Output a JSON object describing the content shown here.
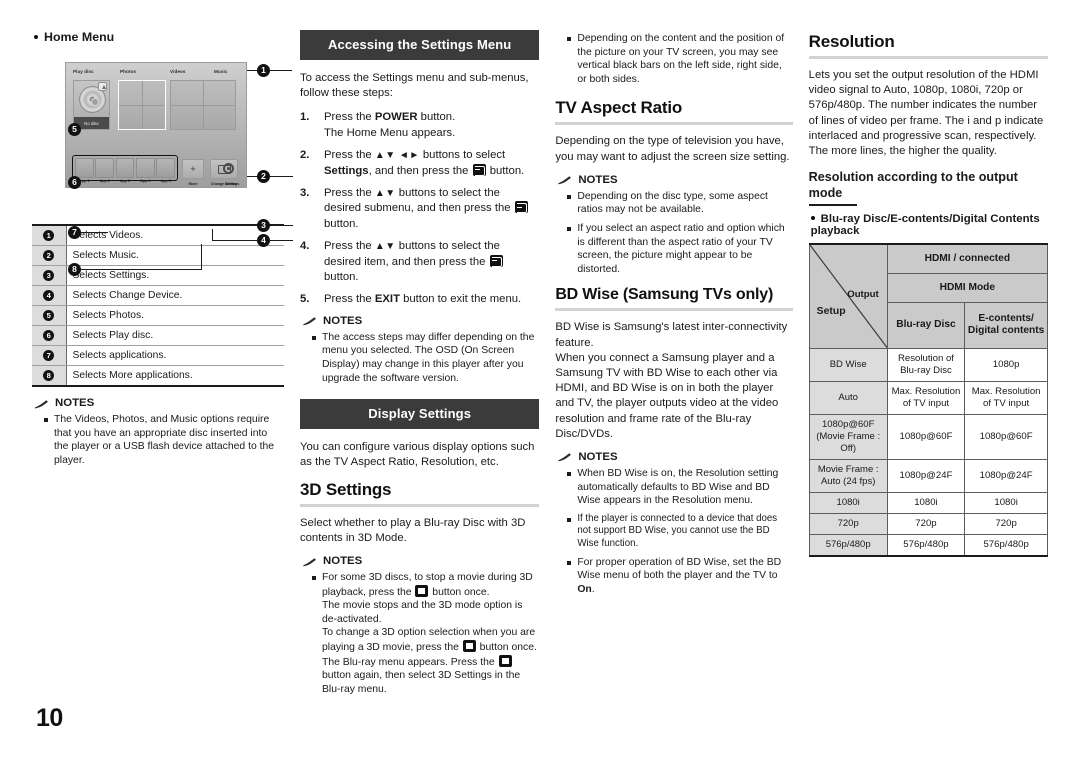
{
  "page": {
    "number": "10"
  },
  "col1": {
    "home_menu_heading": "Home Menu",
    "screenshot": {
      "labels": {
        "play_disc": "Play disc",
        "photos": "Photos",
        "videos": "Videos",
        "music": "Music",
        "no_disc": "No disc",
        "apps": [
          "App 1",
          "App 2",
          "App 3",
          "App 4",
          "App 5"
        ],
        "more": "More",
        "change_device": "Change Device",
        "settings": "Settings"
      },
      "callouts": [
        "1",
        "2",
        "3",
        "4",
        "5",
        "6",
        "7",
        "8"
      ]
    },
    "legend": [
      {
        "num": "1",
        "text": "Selects Videos."
      },
      {
        "num": "2",
        "text": "Selects Music."
      },
      {
        "num": "3",
        "text": "Selects Settings."
      },
      {
        "num": "4",
        "text": "Selects Change Device."
      },
      {
        "num": "5",
        "text": "Selects Photos."
      },
      {
        "num": "6",
        "text": "Selects Play disc."
      },
      {
        "num": "7",
        "text": "Selects applications."
      },
      {
        "num": "8",
        "text": "Selects More applications."
      }
    ],
    "notes_title": "NOTES",
    "notes": [
      "The Videos, Photos, and Music options require that you have an appropriate disc inserted into the player or a USB flash device attached to the player."
    ]
  },
  "col2": {
    "section_title": "Accessing the Settings Menu",
    "intro": "To access the Settings menu and sub-menus, follow these steps:",
    "steps": [
      {
        "num": "1.",
        "html": "Press the <b>POWER</b> button.<br>The Home Menu appears."
      },
      {
        "num": "2.",
        "html": "Press the <span class=\"arrows\">▲▼ ◄►</span> buttons to select <b>Settings</b>, and then press the <span class=\"key enter\"></span> button."
      },
      {
        "num": "3.",
        "html": "Press the <span class=\"arrows\">▲▼</span> buttons to select the desired submenu, and then press the <span class=\"key enter\"></span> button."
      },
      {
        "num": "4.",
        "html": "Press the <span class=\"arrows\">▲▼</span> buttons to select the desired item, and then press the <span class=\"key enter\"></span> button."
      },
      {
        "num": "5.",
        "html": "Press the <b>EXIT</b> button to exit the menu."
      }
    ],
    "notes_title": "NOTES",
    "notes": [
      "The access steps may differ depending on the menu you selected. The OSD (On Screen Display) may change in this player after you upgrade the software version."
    ],
    "display_settings_bar": "Display Settings",
    "display_settings_body": "You can configure various display options such as the TV Aspect Ratio, Resolution, etc.",
    "three_d_heading": "3D Settings",
    "three_d_body": "Select whether to play a Blu-ray Disc with 3D contents in 3D Mode.",
    "three_d_notes_title": "NOTES",
    "three_d_note_html": "For some 3D discs, to stop a movie during 3D playback, press the <span class=\"key stop\"></span> button once.<br>The movie stops and the 3D mode option is de-activated.<br>To change a 3D option selection when you are playing a 3D movie, press the <span class=\"key stop\"></span> button once.<br>The Blu-ray menu appears. Press the <span class=\"key stop\"></span> button again, then select 3D Settings in the Blu-ray menu."
  },
  "col3": {
    "top_note": "Depending on the content and the position of the picture on your TV screen, you may see vertical black bars on the left side, right side, or both sides.",
    "aspect_heading": "TV Aspect Ratio",
    "aspect_body": "Depending on the type of television you have, you may want to adjust the screen size setting.",
    "aspect_notes_title": "NOTES",
    "aspect_notes": [
      "Depending on the disc type, some aspect ratios may not be available.",
      "If you select an aspect ratio and option which is different than the aspect ratio of your TV screen, the picture might appear to be distorted."
    ],
    "bdwise_heading": "BD Wise (Samsung TVs only)",
    "bdwise_body": "BD Wise is Samsung's latest inter-connectivity feature.\nWhen you connect a Samsung player and a Samsung TV with BD Wise to each other via HDMI, and BD Wise is on in both the player and TV, the player outputs video at the video resolution and frame rate of the Blu-ray Disc/DVDs.",
    "bdwise_notes_title": "NOTES",
    "bdwise_notes": [
      {
        "html": "When BD Wise is on, the Resolution setting automatically defaults to BD Wise and BD Wise appears in the Resolution menu.",
        "tight": false
      },
      {
        "html": "If the player is connected to a device that does not support BD Wise, you cannot use the BD Wise function.",
        "tight": true
      },
      {
        "html": "For proper operation of BD Wise, set the BD Wise menu of both the player and the TV to <b>On</b>.",
        "tight": false
      }
    ]
  },
  "col4": {
    "resolution_heading": "Resolution",
    "resolution_body": "Lets you set the output resolution of the HDMI video signal to Auto, 1080p, 1080i, 720p or 576p/480p. The number indicates the number of lines of video per frame. The i and p indicate interlaced and progressive scan, respectively. The more lines, the higher the quality.",
    "sub_heading": "Resolution according to the output mode",
    "bullet": "Blu-ray Disc/E-contents/Digital Contents playback",
    "table": {
      "corner_output": "Output",
      "corner_setup": "Setup",
      "top_header": "HDMI / connected",
      "second_header": "HDMI Mode",
      "col_headers": [
        "Blu-ray Disc",
        "E-contents/ Digital contents"
      ],
      "rows": [
        {
          "setup": "BD Wise",
          "bluray": "Resolution of Blu-ray Disc",
          "econtents": "1080p"
        },
        {
          "setup": "Auto",
          "bluray": "Max. Resolution of TV input",
          "econtents": "Max. Resolution of TV input"
        },
        {
          "setup": "1080p@60F (Movie Frame : Off)",
          "bluray": "1080p@60F",
          "econtents": "1080p@60F"
        },
        {
          "setup": "Movie Frame : Auto (24 fps)",
          "bluray": "1080p@24F",
          "econtents": "1080p@24F"
        },
        {
          "setup": "1080i",
          "bluray": "1080i",
          "econtents": "1080i"
        },
        {
          "setup": "720p",
          "bluray": "720p",
          "econtents": "720p"
        },
        {
          "setup": "576p/480p",
          "bluray": "576p/480p",
          "econtents": "576p/480p"
        }
      ]
    }
  },
  "colors": {
    "section_bar": "#3b3b3b",
    "rule": "#d2d2d2",
    "table_header": "#cacaca",
    "table_rowhead": "#dcdcdc"
  }
}
